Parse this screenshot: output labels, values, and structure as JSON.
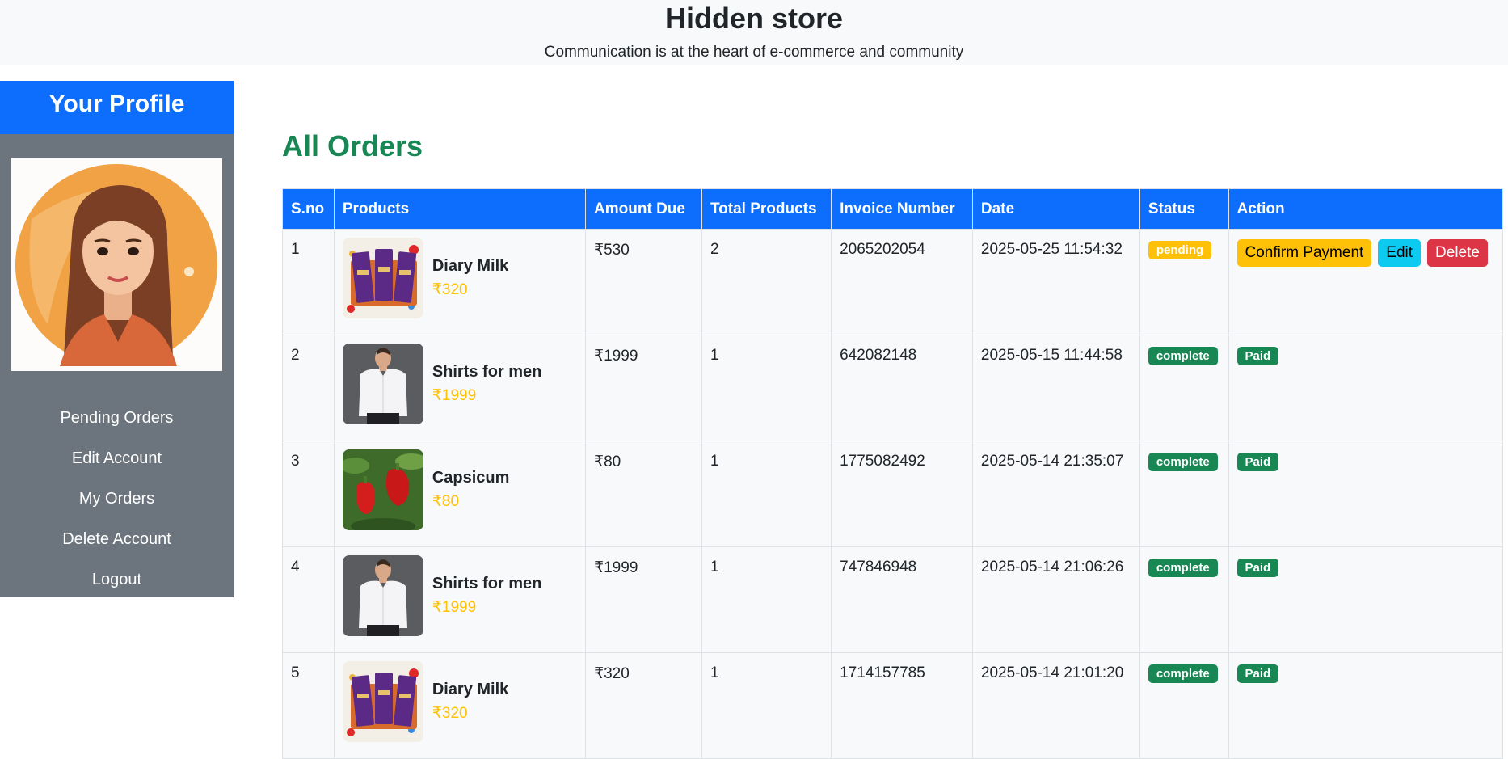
{
  "header": {
    "title": "Hidden store",
    "tagline": "Communication is at the heart of e-commerce and community"
  },
  "sidebar": {
    "heading": "Your Profile",
    "avatar": "woman-avatar",
    "links": [
      "Pending Orders",
      "Edit Account",
      "My Orders",
      "Delete Account",
      "Logout"
    ]
  },
  "main": {
    "heading": "All Orders",
    "columns": [
      "S.no",
      "Products",
      "Amount Due",
      "Total Products",
      "Invoice Number",
      "Date",
      "Status",
      "Action"
    ],
    "rows": [
      {
        "sno": "1",
        "product": "Diary Milk",
        "price": "₹320",
        "image": "chocolate",
        "amount": "₹530",
        "total": "2",
        "invoice": "2065202054",
        "date": "2025-05-25 11:54:32",
        "status": "pending",
        "actions": [
          "Confirm Payment",
          "Edit",
          "Delete"
        ]
      },
      {
        "sno": "2",
        "product": "Shirts for men",
        "price": "₹1999",
        "image": "shirt",
        "amount": "₹1999",
        "total": "1",
        "invoice": "642082148",
        "date": "2025-05-15 11:44:58",
        "status": "complete",
        "payment": "Paid"
      },
      {
        "sno": "3",
        "product": "Capsicum",
        "price": "₹80",
        "image": "capsicum",
        "amount": "₹80",
        "total": "1",
        "invoice": "1775082492",
        "date": "2025-05-14 21:35:07",
        "status": "complete",
        "payment": "Paid"
      },
      {
        "sno": "4",
        "product": "Shirts for men",
        "price": "₹1999",
        "image": "shirt",
        "amount": "₹1999",
        "total": "1",
        "invoice": "747846948",
        "date": "2025-05-14 21:06:26",
        "status": "complete",
        "payment": "Paid"
      },
      {
        "sno": "5",
        "product": "Diary Milk",
        "price": "₹320",
        "image": "chocolate",
        "amount": "₹320",
        "total": "1",
        "invoice": "1714157785",
        "date": "2025-05-14 21:01:20",
        "status": "complete",
        "payment": "Paid"
      }
    ]
  },
  "colors": {
    "primary": "#0d6efd",
    "success": "#198754",
    "warning": "#ffc107",
    "info": "#0dcaf0",
    "danger": "#dc3545",
    "sidebar": "#6c757d"
  }
}
